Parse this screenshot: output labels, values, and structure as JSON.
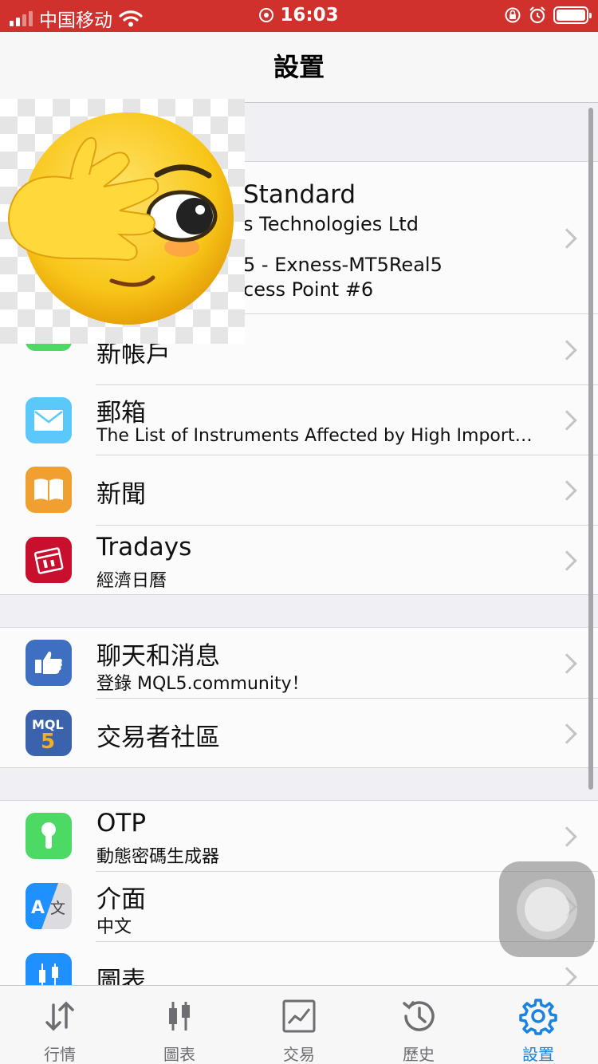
{
  "status_bar": {
    "carrier": "中国移动",
    "time": "16:03"
  },
  "nav": {
    "title": "設置"
  },
  "account": {
    "line1": "Standard",
    "line2": "s Technologies Ltd",
    "line3": "5 - Exness-MT5Real5",
    "line4": "cess Point #6"
  },
  "groups": [
    {
      "items": [
        {
          "title": "新帳戶",
          "subtitle": "",
          "icon": "add-user-icon",
          "color": "#4cd964"
        },
        {
          "title": "郵箱",
          "subtitle": "The List of Instruments Affected by High Importance News",
          "icon": "mail-icon",
          "color": "#5ac8fa"
        },
        {
          "title": "新聞",
          "subtitle": "",
          "icon": "book-icon",
          "color": "#f0a030"
        },
        {
          "title": "Tradays",
          "subtitle": "經濟日曆",
          "icon": "calendar-icon",
          "color": "#c8102e"
        }
      ]
    },
    {
      "items": [
        {
          "title": "聊天和消息",
          "subtitle": "登錄 MQL5.community！",
          "icon": "thumbs-up-icon",
          "color": "#3f6fc0"
        },
        {
          "title": "交易者社區",
          "subtitle": "",
          "icon": "mql5-icon",
          "color": "#3a62ad"
        }
      ]
    },
    {
      "items": [
        {
          "title": "OTP",
          "subtitle": "動態密碼生成器",
          "icon": "keyhole-icon",
          "color": "#4cd964"
        },
        {
          "title": "介面",
          "subtitle": "中文",
          "icon": "translate-icon",
          "color": "#1e90ff"
        },
        {
          "title": "圖表",
          "subtitle": "",
          "icon": "chart-icon",
          "color": "#1e90ff"
        }
      ]
    }
  ],
  "tabs": [
    {
      "label": "行情",
      "icon": "quotes-icon",
      "active": false
    },
    {
      "label": "圖表",
      "icon": "chart-icon",
      "active": false
    },
    {
      "label": "交易",
      "icon": "trade-icon",
      "active": false
    },
    {
      "label": "歷史",
      "icon": "history-icon",
      "active": false
    },
    {
      "label": "設置",
      "icon": "settings-icon",
      "active": true
    }
  ],
  "colors": {
    "accent": "#1a82e0",
    "status_bar": "#d0312d"
  }
}
